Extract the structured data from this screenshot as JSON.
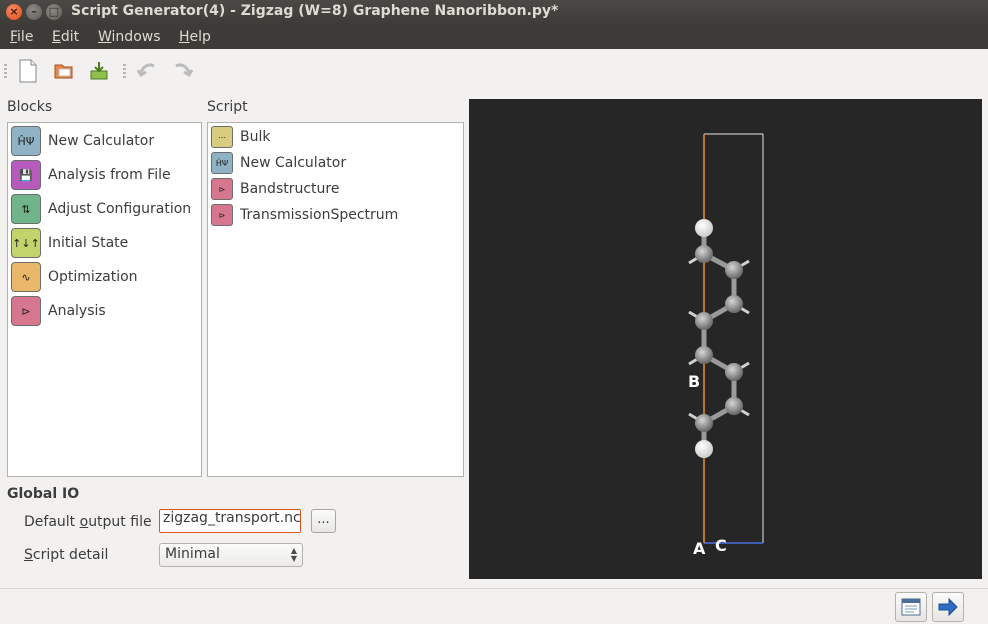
{
  "window": {
    "title": "Script Generator(4) - Zigzag (W=8) Graphene Nanoribbon.py*",
    "controls": {
      "close": "×",
      "minimize": "–",
      "maximize": "□"
    }
  },
  "menu": {
    "file_first": "F",
    "file_rest": "ile",
    "edit_first": "E",
    "edit_rest": "dit",
    "windows_first": "W",
    "windows_rest": "indows",
    "help_first": "H",
    "help_rest": "elp"
  },
  "toolbar": {
    "icons": [
      "new-file-icon",
      "open-folder-icon",
      "save-download-icon",
      "undo-icon",
      "redo-icon"
    ]
  },
  "blocks": {
    "heading": "Blocks",
    "items": [
      {
        "label": "New Calculator",
        "icon": "calculator-icon",
        "glyph": "ĤΨ",
        "color": "#8fb2c4"
      },
      {
        "label": "Analysis from File",
        "icon": "analysis-file-icon",
        "glyph": "💾",
        "color": "#b65bbd"
      },
      {
        "label": "Adjust Configuration",
        "icon": "adjust-config-icon",
        "glyph": "⇅",
        "color": "#6fb589"
      },
      {
        "label": "Initial State",
        "icon": "initial-state-icon",
        "glyph": "↑↓↑",
        "color": "#c2d46b"
      },
      {
        "label": "Optimization",
        "icon": "optimization-icon",
        "glyph": "∿",
        "color": "#e8b76a"
      },
      {
        "label": "Analysis",
        "icon": "analysis-icon",
        "glyph": "⊳",
        "color": "#d7768f"
      }
    ]
  },
  "script": {
    "heading": "Script",
    "items": [
      {
        "label": "Bulk",
        "icon": "bulk-icon",
        "glyph": "⋯",
        "color": "#d9cc7e"
      },
      {
        "label": "New Calculator",
        "icon": "calculator-icon",
        "glyph": "ĤΨ",
        "color": "#8fb2c4"
      },
      {
        "label": "Bandstructure",
        "icon": "bandstructure-icon",
        "glyph": "⊳",
        "color": "#d7768f"
      },
      {
        "label": "TransmissionSpectrum",
        "icon": "transmission-icon",
        "glyph": "⊳",
        "color": "#d7768f"
      }
    ]
  },
  "global_io": {
    "heading": "Global IO",
    "output_label_pre": "Default ",
    "output_label_key": "o",
    "output_label_post": "utput file",
    "output_value": "zigzag_transport.nc",
    "browse_label": "...",
    "detail_label_key": "S",
    "detail_label_rest": "cript detail",
    "detail_value": "Minimal"
  },
  "viewer": {
    "axis_labels": {
      "a": "A",
      "b": "B",
      "c": "C"
    },
    "colors": {
      "background": "#262626",
      "cell_a": "#e8912c",
      "cell_outline": "#e6e6e6",
      "cell_c": "#4a6fe0"
    }
  },
  "bottom": {
    "icons": [
      "script-view-icon",
      "send-to-editor-icon"
    ]
  }
}
